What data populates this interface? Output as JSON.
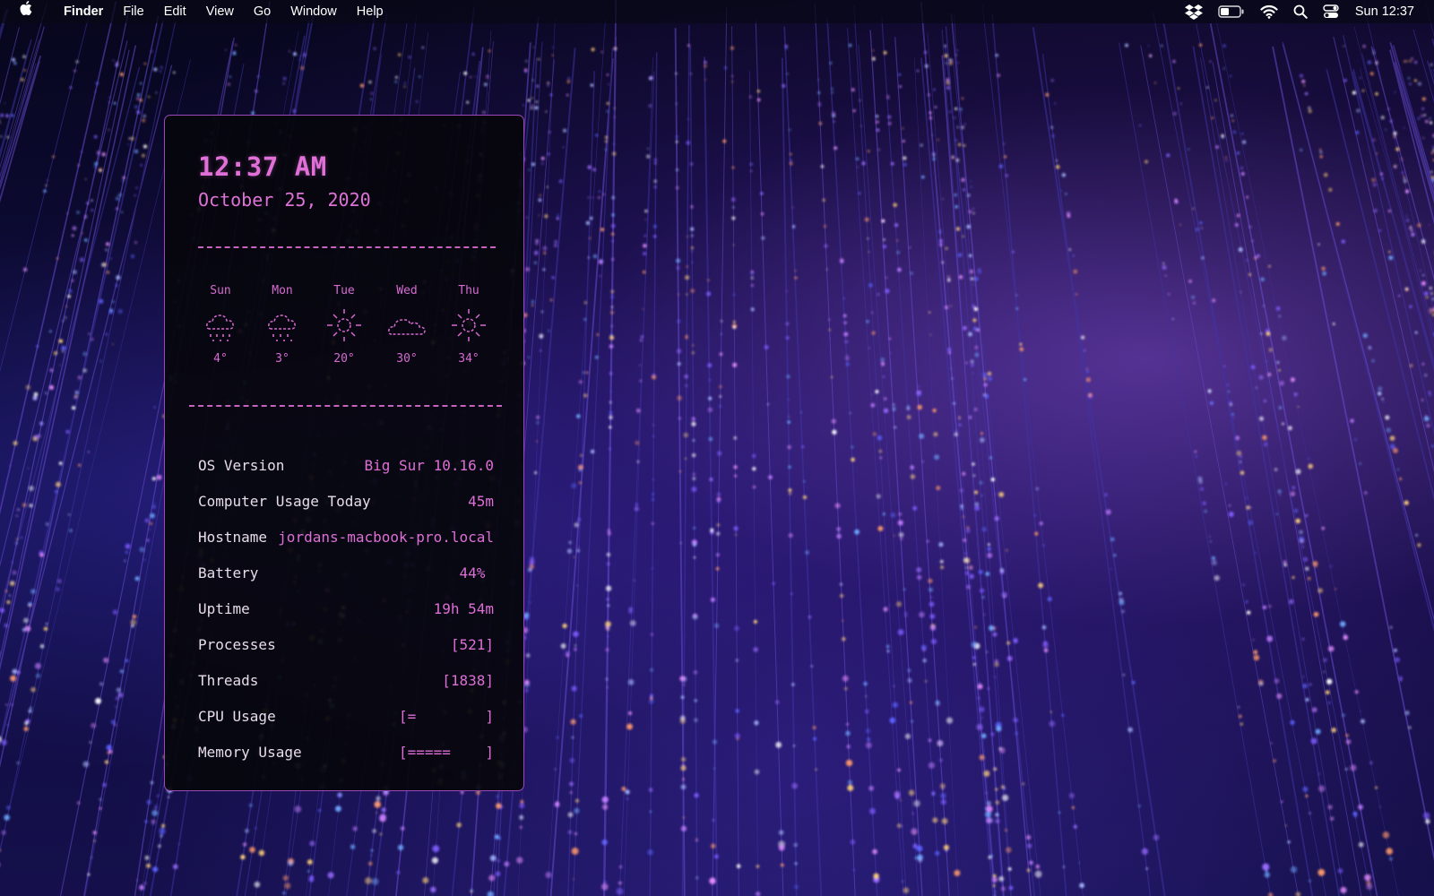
{
  "menubar": {
    "apple_icon": "apple-icon",
    "app_name": "Finder",
    "menus": [
      "File",
      "Edit",
      "View",
      "Go",
      "Window",
      "Help"
    ],
    "status_icons": [
      "dropbox-icon",
      "battery-icon",
      "wifi-icon",
      "search-icon",
      "control-center-icon"
    ],
    "clock": "Sun 12:37"
  },
  "widget": {
    "time": "12:37 AM",
    "date": "October 25, 2020",
    "forecast": [
      {
        "day": "Sun",
        "icon": "rain-cloud-icon",
        "temp": "4°"
      },
      {
        "day": "Mon",
        "icon": "rain-cloud-icon",
        "temp": "3°"
      },
      {
        "day": "Tue",
        "icon": "sun-icon",
        "temp": "20°"
      },
      {
        "day": "Wed",
        "icon": "cloud-icon",
        "temp": "30°"
      },
      {
        "day": "Thu",
        "icon": "sun-icon",
        "temp": "34°"
      }
    ],
    "info": [
      {
        "label": "OS Version",
        "value": "Big Sur 10.16.0"
      },
      {
        "label": "Computer Usage Today",
        "value": "45m"
      },
      {
        "label": "Hostname",
        "value": "jordans-macbook-pro.local"
      },
      {
        "label": "Battery",
        "value": "44% "
      },
      {
        "label": "Uptime",
        "value": "19h 54m"
      },
      {
        "label": "Processes",
        "value": "[521]"
      },
      {
        "label": "Threads",
        "value": "[1838]"
      },
      {
        "label": "CPU Usage",
        "value": "[=        ]"
      },
      {
        "label": "Memory Usage",
        "value": "[=====    ]"
      }
    ]
  },
  "colors": {
    "accent": "#de6fd5",
    "border": "#9c48b8",
    "widget_bg": "#06060c",
    "label_text": "#e8dcea"
  }
}
